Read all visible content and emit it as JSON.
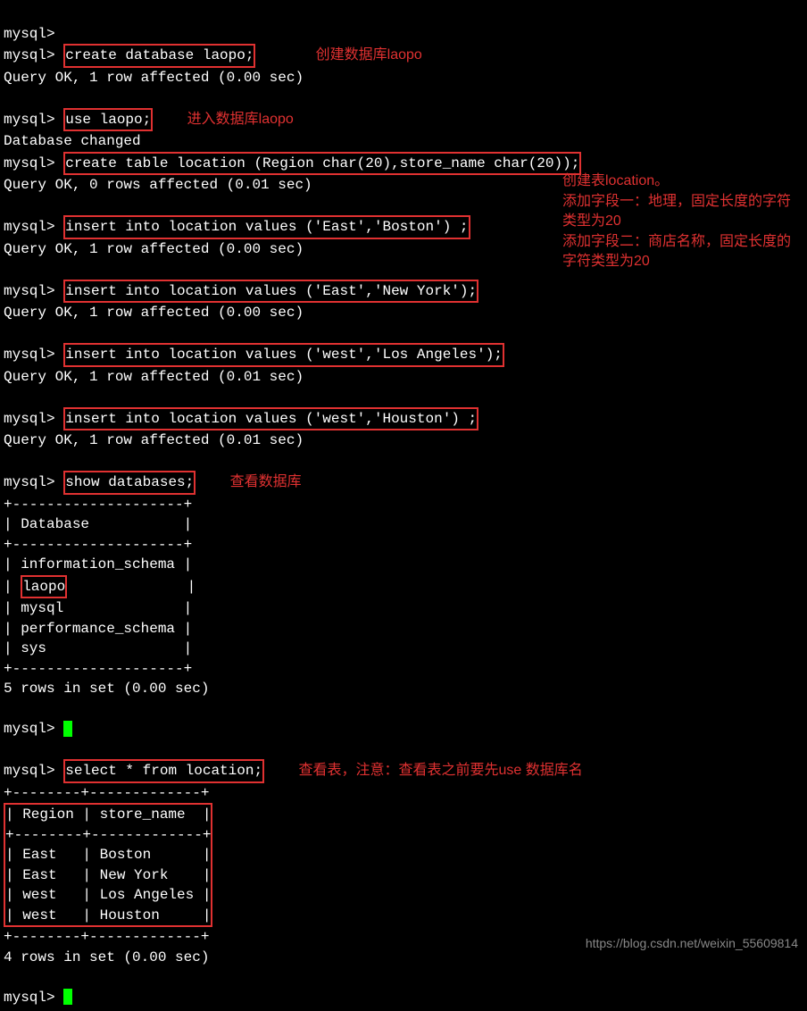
{
  "prompt": "mysql>",
  "lines": {
    "cmd_create_db": "create database laopo;",
    "ann_create_db": "创建数据库laopo",
    "res_query_ok_1row_000": "Query OK, 1 row affected (0.00 sec)",
    "res_query_ok_0rows_001": "Query OK, 0 rows affected (0.01 sec)",
    "res_query_ok_1row_001": "Query OK, 1 row affected (0.01 sec)",
    "cmd_use": "use laopo;",
    "ann_use": "进入数据库laopo",
    "res_db_changed": "Database changed",
    "cmd_create_table": "create table location (Region char(20),store_name char(20));",
    "ann_create_table_1": "创建表location。",
    "ann_create_table_2": "添加字段一：地理，固定长度的字符类型为20",
    "ann_create_table_3": "添加字段二：商店名称，固定长度的字符类型为20",
    "cmd_insert1": "insert into location values ('East','Boston') ;",
    "cmd_insert2": "insert into location values ('East','New York');",
    "cmd_insert3": "insert into location values ('west','Los Angeles');",
    "cmd_insert4": "insert into location values ('west','Houston') ;",
    "cmd_show_db": "show databases;",
    "ann_show_db": "查看数据库",
    "db_border": "+--------------------+",
    "db_header": "| Database           |",
    "db_row1": "| information_schema |",
    "db_row2_pre": "| ",
    "db_row2_box": "laopo",
    "db_row2_post": "              |",
    "db_row3": "| mysql              |",
    "db_row4": "| performance_schema |",
    "db_row5": "| sys                |",
    "db_result": "5 rows in set (0.00 sec)",
    "cmd_select": "select * from location;",
    "ann_select": "查看表，注意：查看表之前要先use 数据库名",
    "tbl_border": "+--------+-------------+",
    "tbl_header": "| Region | store_name  |",
    "tbl_row1": "| East   | Boston      |",
    "tbl_row2": "| East   | New York    |",
    "tbl_row3": "| west   | Los Angeles |",
    "tbl_row4": "| west   | Houston     |",
    "tbl_result": "4 rows in set (0.00 sec)"
  },
  "watermark": "https://blog.csdn.net/weixin_55609814"
}
